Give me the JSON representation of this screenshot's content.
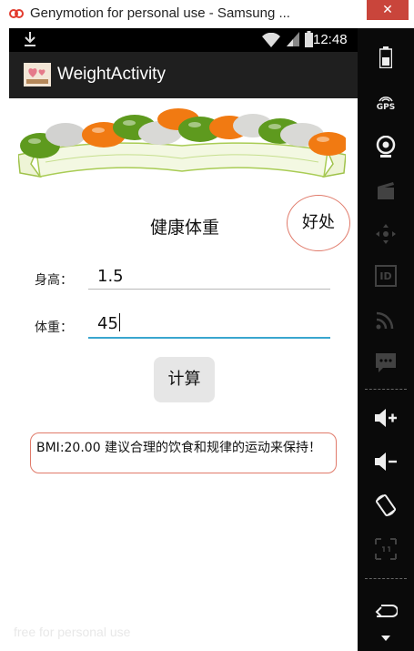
{
  "window": {
    "title": "Genymotion for personal use - Samsung ...",
    "close_glyph": "✕"
  },
  "status_bar": {
    "time": "12:48",
    "icons": [
      "download-icon",
      "wifi-icon",
      "signal-icon",
      "battery-icon"
    ]
  },
  "action_bar": {
    "title": "WeightActivity"
  },
  "main": {
    "heading": "健康体重",
    "benefit_button": "好处",
    "height_label": "身高：",
    "height_value": "1.5",
    "weight_label": "体重：",
    "weight_value": "45",
    "calculate_button": "计算",
    "result_text": "BMI:20.00    建议合理的饮食和规律的运动来保持！"
  },
  "watermark": "free for personal use",
  "toolbar": {
    "gps_label": "GPS",
    "id_label": "ID",
    "icons": [
      "battery-icon",
      "gps-icon",
      "camera-icon",
      "video-icon",
      "dpad-icon",
      "id-icon",
      "rss-icon",
      "sms-icon",
      "volume-up-icon",
      "volume-down-icon",
      "rotate-icon",
      "scale-icon",
      "back-icon",
      "menu-icon"
    ]
  },
  "colors": {
    "accent": "#3aa6cf",
    "circle_border": "#e07a6a",
    "action_bar": "#1f1f1f",
    "close_button": "#c9453b"
  }
}
